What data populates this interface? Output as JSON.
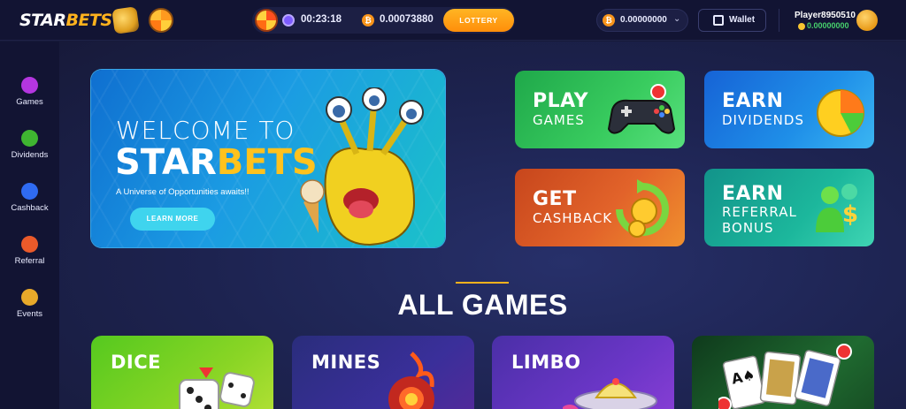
{
  "header": {
    "logo_left": "STAR",
    "logo_right": "BETS",
    "timer": "00:23:18",
    "jackpot": "0.00073880",
    "lottery_label": "LOTTERY",
    "balance": "0.00000000",
    "wallet_label": "Wallet",
    "username": "Player8950510",
    "user_balance": "0.00000000"
  },
  "sidebar": {
    "items": [
      {
        "label": "Games",
        "icon": "gamepad-icon",
        "color": "#b436e0"
      },
      {
        "label": "Dividends",
        "icon": "dividends-icon",
        "color": "#3fb531"
      },
      {
        "label": "Cashback",
        "icon": "cashback-icon",
        "color": "#2f6bf2"
      },
      {
        "label": "Referral",
        "icon": "referral-icon",
        "color": "#ea5a2a"
      },
      {
        "label": "Events",
        "icon": "events-icon",
        "color": "#e8a92a"
      }
    ]
  },
  "hero": {
    "welcome": "WELCOME TO",
    "brand_a": "STAR",
    "brand_b": "BETS",
    "tagline": "A Universe of Opportunities awaits!!",
    "button": "LEARN MORE"
  },
  "cards": {
    "play": {
      "line1": "PLAY",
      "line2": "GAMES"
    },
    "earn": {
      "line1": "EARN",
      "line2": "DIVIDENDS"
    },
    "cash": {
      "line1": "GET",
      "line2": "CASHBACK"
    },
    "ref": {
      "line1": "EARN",
      "line2": "REFERRAL",
      "line3": "BONUS"
    }
  },
  "section_title": "ALL GAMES",
  "games": [
    "DICE",
    "MINES",
    "LIMBO"
  ],
  "colors": {
    "accent": "#ffb21d",
    "btc": "#f7931a",
    "positive": "#47d16c"
  }
}
